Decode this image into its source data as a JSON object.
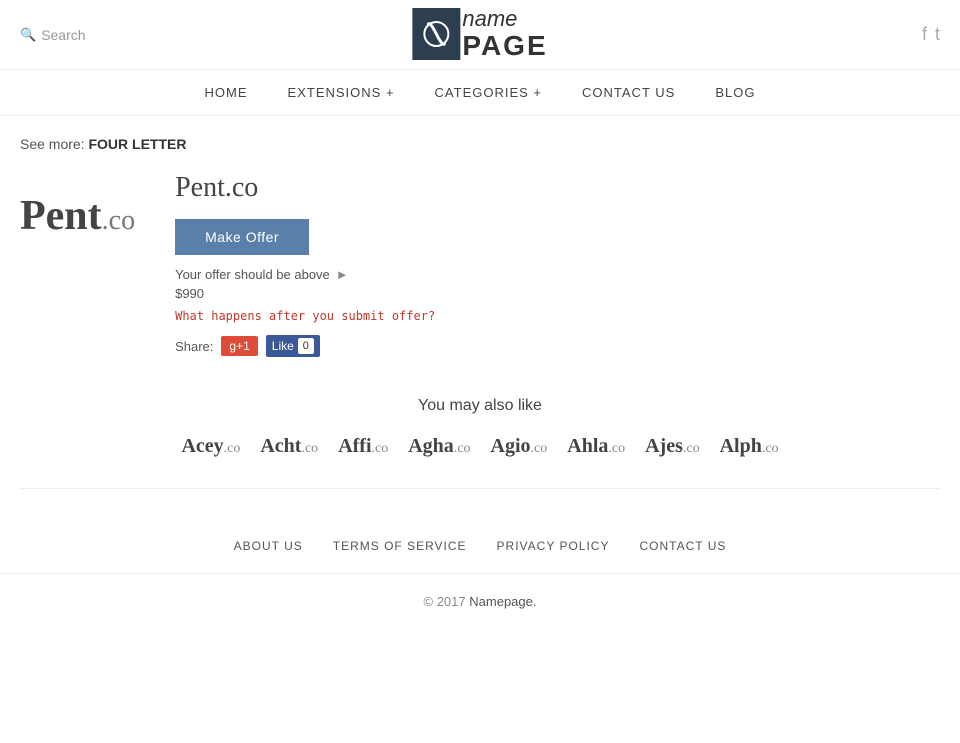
{
  "header": {
    "search_label": "Search",
    "logo_icon": "n",
    "logo_name": "name",
    "logo_page": "PAGE",
    "social": {
      "facebook_label": "Facebook",
      "twitter_label": "Twitter"
    }
  },
  "nav": {
    "items": [
      {
        "label": "HOME",
        "id": "home"
      },
      {
        "label": "EXTENSIONS +",
        "id": "extensions"
      },
      {
        "label": "CATEGORIES +",
        "id": "categories"
      },
      {
        "label": "CONTACT  US",
        "id": "contact"
      },
      {
        "label": "BLOG",
        "id": "blog"
      }
    ]
  },
  "breadcrumb": {
    "prefix": "See more:",
    "link_text": "FOUR LETTER"
  },
  "domain": {
    "name": "Pent",
    "tld": ".co",
    "full": "Pent.co",
    "make_offer_label": "Make Offer",
    "offer_info": "Your offer should be above",
    "offer_amount": "$990",
    "what_happens": "What happens after you submit offer?",
    "share_label": "Share:",
    "gplus_label": "g+1",
    "fb_label": "Like",
    "fb_count": "0"
  },
  "also_like": {
    "title": "You may also like",
    "domains": [
      {
        "name": "Acey",
        "tld": ".co"
      },
      {
        "name": "Acht",
        "tld": ".co"
      },
      {
        "name": "Affi",
        "tld": ".co"
      },
      {
        "name": "Agha",
        "tld": ".co"
      },
      {
        "name": "Agio",
        "tld": ".co"
      },
      {
        "name": "Ahla",
        "tld": ".co"
      },
      {
        "name": "Ajes",
        "tld": ".co"
      },
      {
        "name": "Alph",
        "tld": ".co"
      }
    ]
  },
  "footer": {
    "links": [
      {
        "label": "ABOUT  US",
        "id": "about"
      },
      {
        "label": "TERMS  OF  SERVICE",
        "id": "terms"
      },
      {
        "label": "PRIVACY  POLICY",
        "id": "privacy"
      },
      {
        "label": "CONTACT  US",
        "id": "contact"
      }
    ],
    "copyright": "© 2017",
    "brand": "Namepage."
  }
}
